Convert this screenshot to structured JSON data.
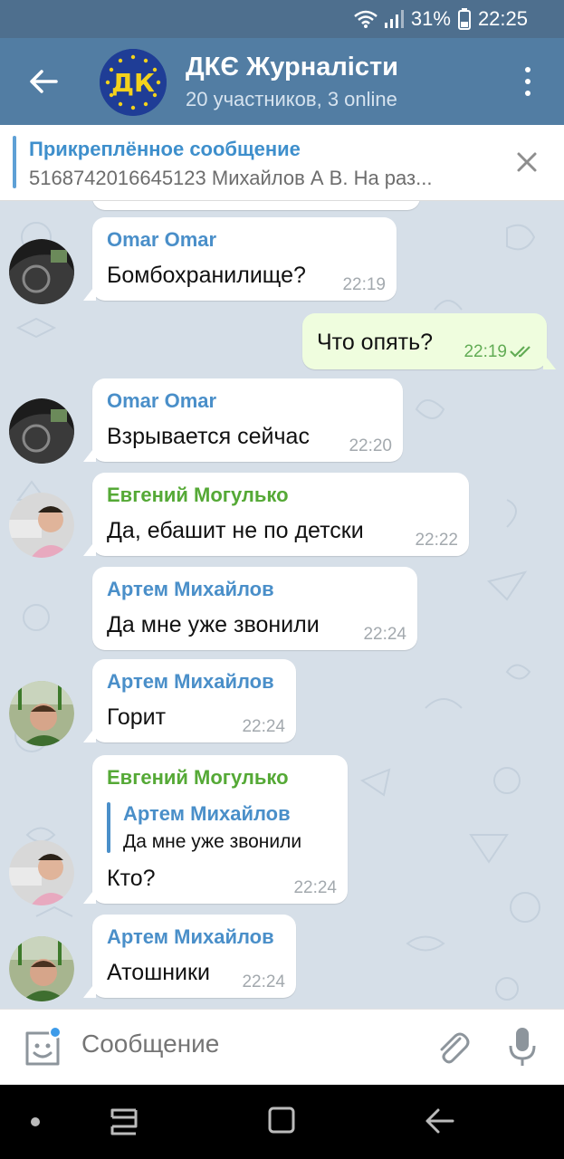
{
  "status_bar": {
    "battery": "31%",
    "time": "22:25"
  },
  "header": {
    "title": "ДКЄ Журналісти",
    "subtitle": "20 участников, 3 online",
    "avatar_letters": "ДК",
    "accent_color": "#527da3"
  },
  "pinned": {
    "title": "Прикреплённое сообщение",
    "text": "5168742016645123 Михайлов А В. На раз..."
  },
  "messages": [
    {
      "sender": "Omar Omar",
      "text": "Бомбохранилище?",
      "time": "22:19"
    },
    {
      "text": "Что опять?",
      "time": "22:19",
      "outgoing": true,
      "read": true
    },
    {
      "sender": "Omar Omar",
      "text": "Взрывается сейчас",
      "time": "22:20"
    },
    {
      "sender": "Евгений Могулько",
      "text": "Да,  ебашит не по детски",
      "time": "22:22"
    },
    {
      "sender": "Артем Михайлов",
      "text": "Да мне уже звонили",
      "time": "22:24"
    },
    {
      "sender": "Артем Михайлов",
      "text": "Горит",
      "time": "22:24"
    },
    {
      "sender": "Евгений Могулько",
      "reply_name": "Артем Михайлов",
      "reply_text": "Да мне уже звонили",
      "text": "Кто?",
      "time": "22:24"
    },
    {
      "sender": "Артем Михайлов",
      "text": "Атошники",
      "time": "22:24"
    }
  ],
  "input": {
    "placeholder": "Сообщение"
  },
  "icons": {
    "back": "arrow-left-icon",
    "more": "more-vertical-icon",
    "close": "close-icon",
    "emoji": "sticker-icon",
    "attach": "paperclip-icon",
    "mic": "microphone-icon"
  },
  "colors": {
    "sender_blue": "#4a8fc9",
    "sender_green": "#55a936",
    "outgoing_bubble": "#effdde",
    "chat_background": "#d6dfe8"
  }
}
